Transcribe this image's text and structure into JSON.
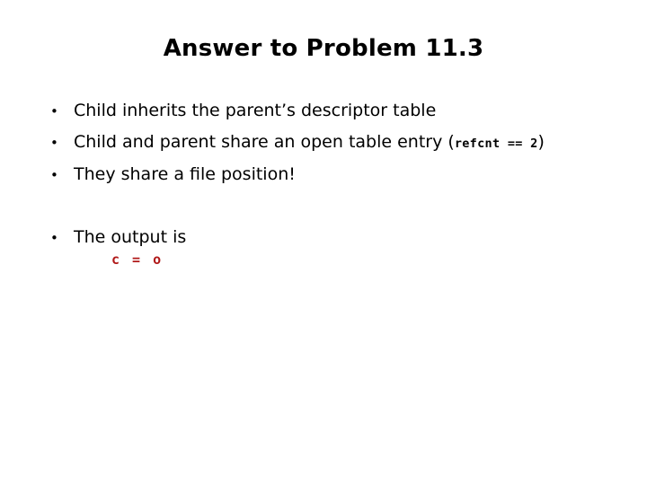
{
  "slide": {
    "title": "Answer to Problem 11.3",
    "background_color": "#ffffff",
    "text_color": "#000000",
    "accent_color": "#b01818",
    "bullet_glyph": "•"
  },
  "bullets": [
    {
      "marker": "•",
      "text": "Child inherits the parent’s descriptor table"
    },
    {
      "marker": "•",
      "text_before": "Child and parent share an open table entry ",
      "open_paren": "(",
      "code": "refcnt == 2",
      "close_paren": ")"
    },
    {
      "marker": "•",
      "text": "They share a file position!"
    },
    {
      "marker": "•",
      "text": "The output is"
    }
  ],
  "output": {
    "code": "c = o"
  }
}
